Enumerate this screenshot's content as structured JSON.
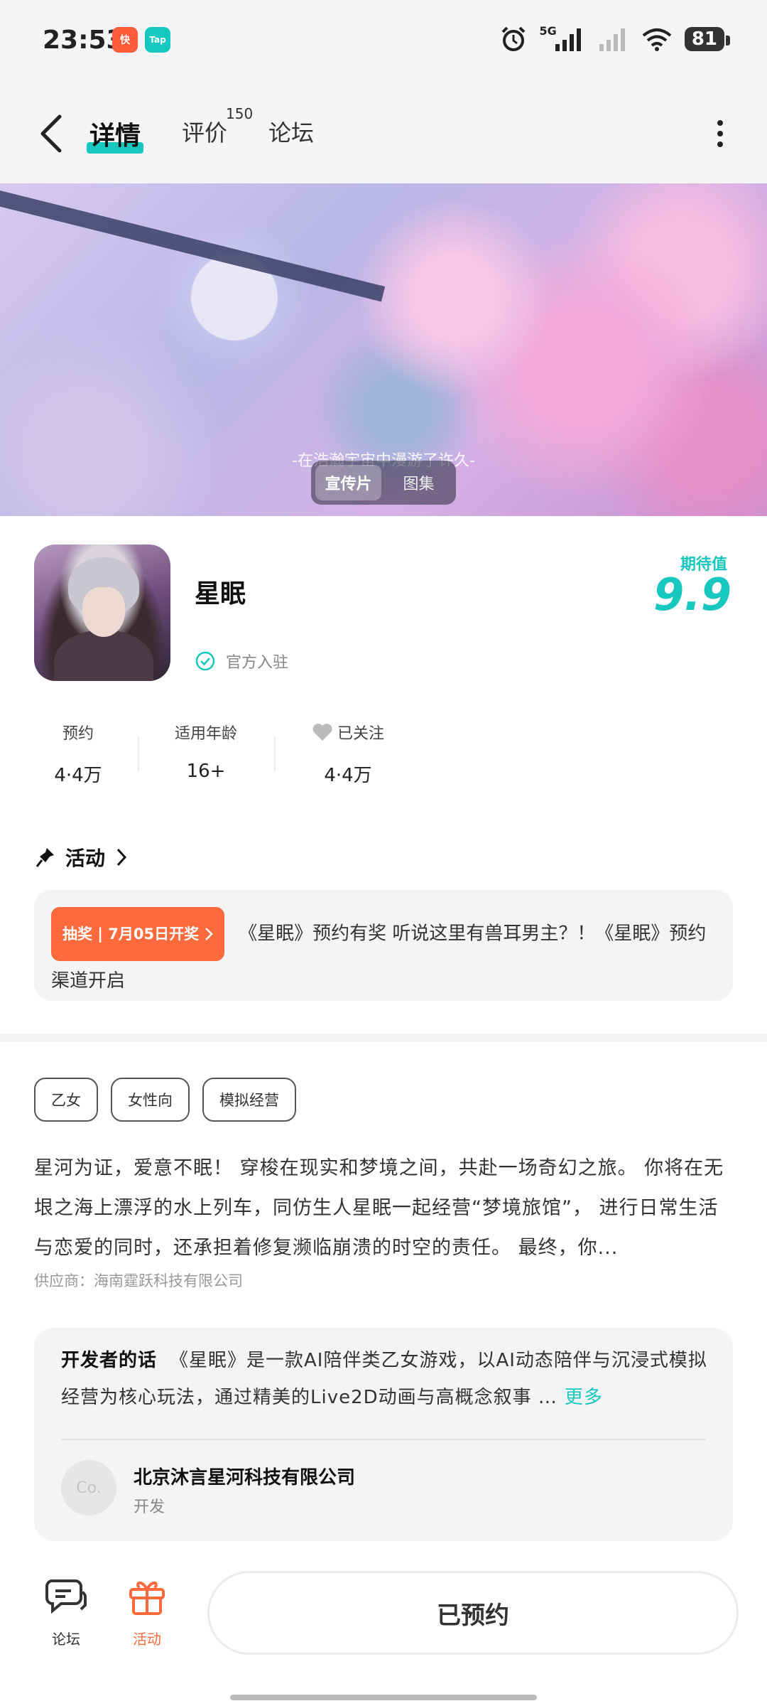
{
  "status_bar": {
    "time": "23:53",
    "app_icon_1": "快",
    "app_icon_2": "Tap",
    "network": "5G",
    "battery": "81"
  },
  "nav": {
    "tabs": [
      {
        "label": "详情",
        "active": true
      },
      {
        "label": "评价",
        "count": "150"
      },
      {
        "label": "论坛"
      }
    ]
  },
  "banner": {
    "caption": "-在浩瀚宇宙中漫游了许久-",
    "toggle": [
      "宣传片",
      "图集"
    ]
  },
  "game": {
    "name": "星眠",
    "official_label": "官方入驻",
    "expect_label": "期待值",
    "expect_score": "9.9"
  },
  "stats": [
    {
      "label": "预约",
      "value": "4·4万"
    },
    {
      "label": "适用年龄",
      "value": "16+"
    },
    {
      "label": "已关注",
      "value": "4·4万"
    }
  ],
  "activity": {
    "header": "活动",
    "badge": "抽奖 | 7月05日开奖",
    "text": "《星眠》预约有奖  听说这里有兽耳男主？！《星眠》预约渠道开启"
  },
  "tags": [
    "乙女",
    "女性向",
    "模拟经营"
  ],
  "description": "星河为证，爱意不眠！ 穿梭在现实和梦境之间，共赴一场奇幻之旅。 你将在无垠之海上漂浮的水上列车，同仿生人星眠一起经营“梦境旅馆”， 进行日常生活与恋爱的同时，还承担着修复濒临崩溃的时空的责任。 最终，你...",
  "supplier": "供应商：海南霆跃科技有限公司",
  "developer": {
    "label": "开发者的话",
    "text": "《星眠》是一款AI陪伴类乙女游戏，以AI动态陪伴与沉浸式模拟经营为核心玩法，通过精美的Live2D动画与高概念叙事 …",
    "more": "更多",
    "avatar_text": "Co.",
    "company": "北京沐言星河科技有限公司",
    "role": "开发"
  },
  "bottom_bar": {
    "forum": "论坛",
    "activity": "活动",
    "reserve_button": "已预约"
  },
  "colors": {
    "accent": "#18c7be",
    "orange": "#ff6a3d"
  }
}
